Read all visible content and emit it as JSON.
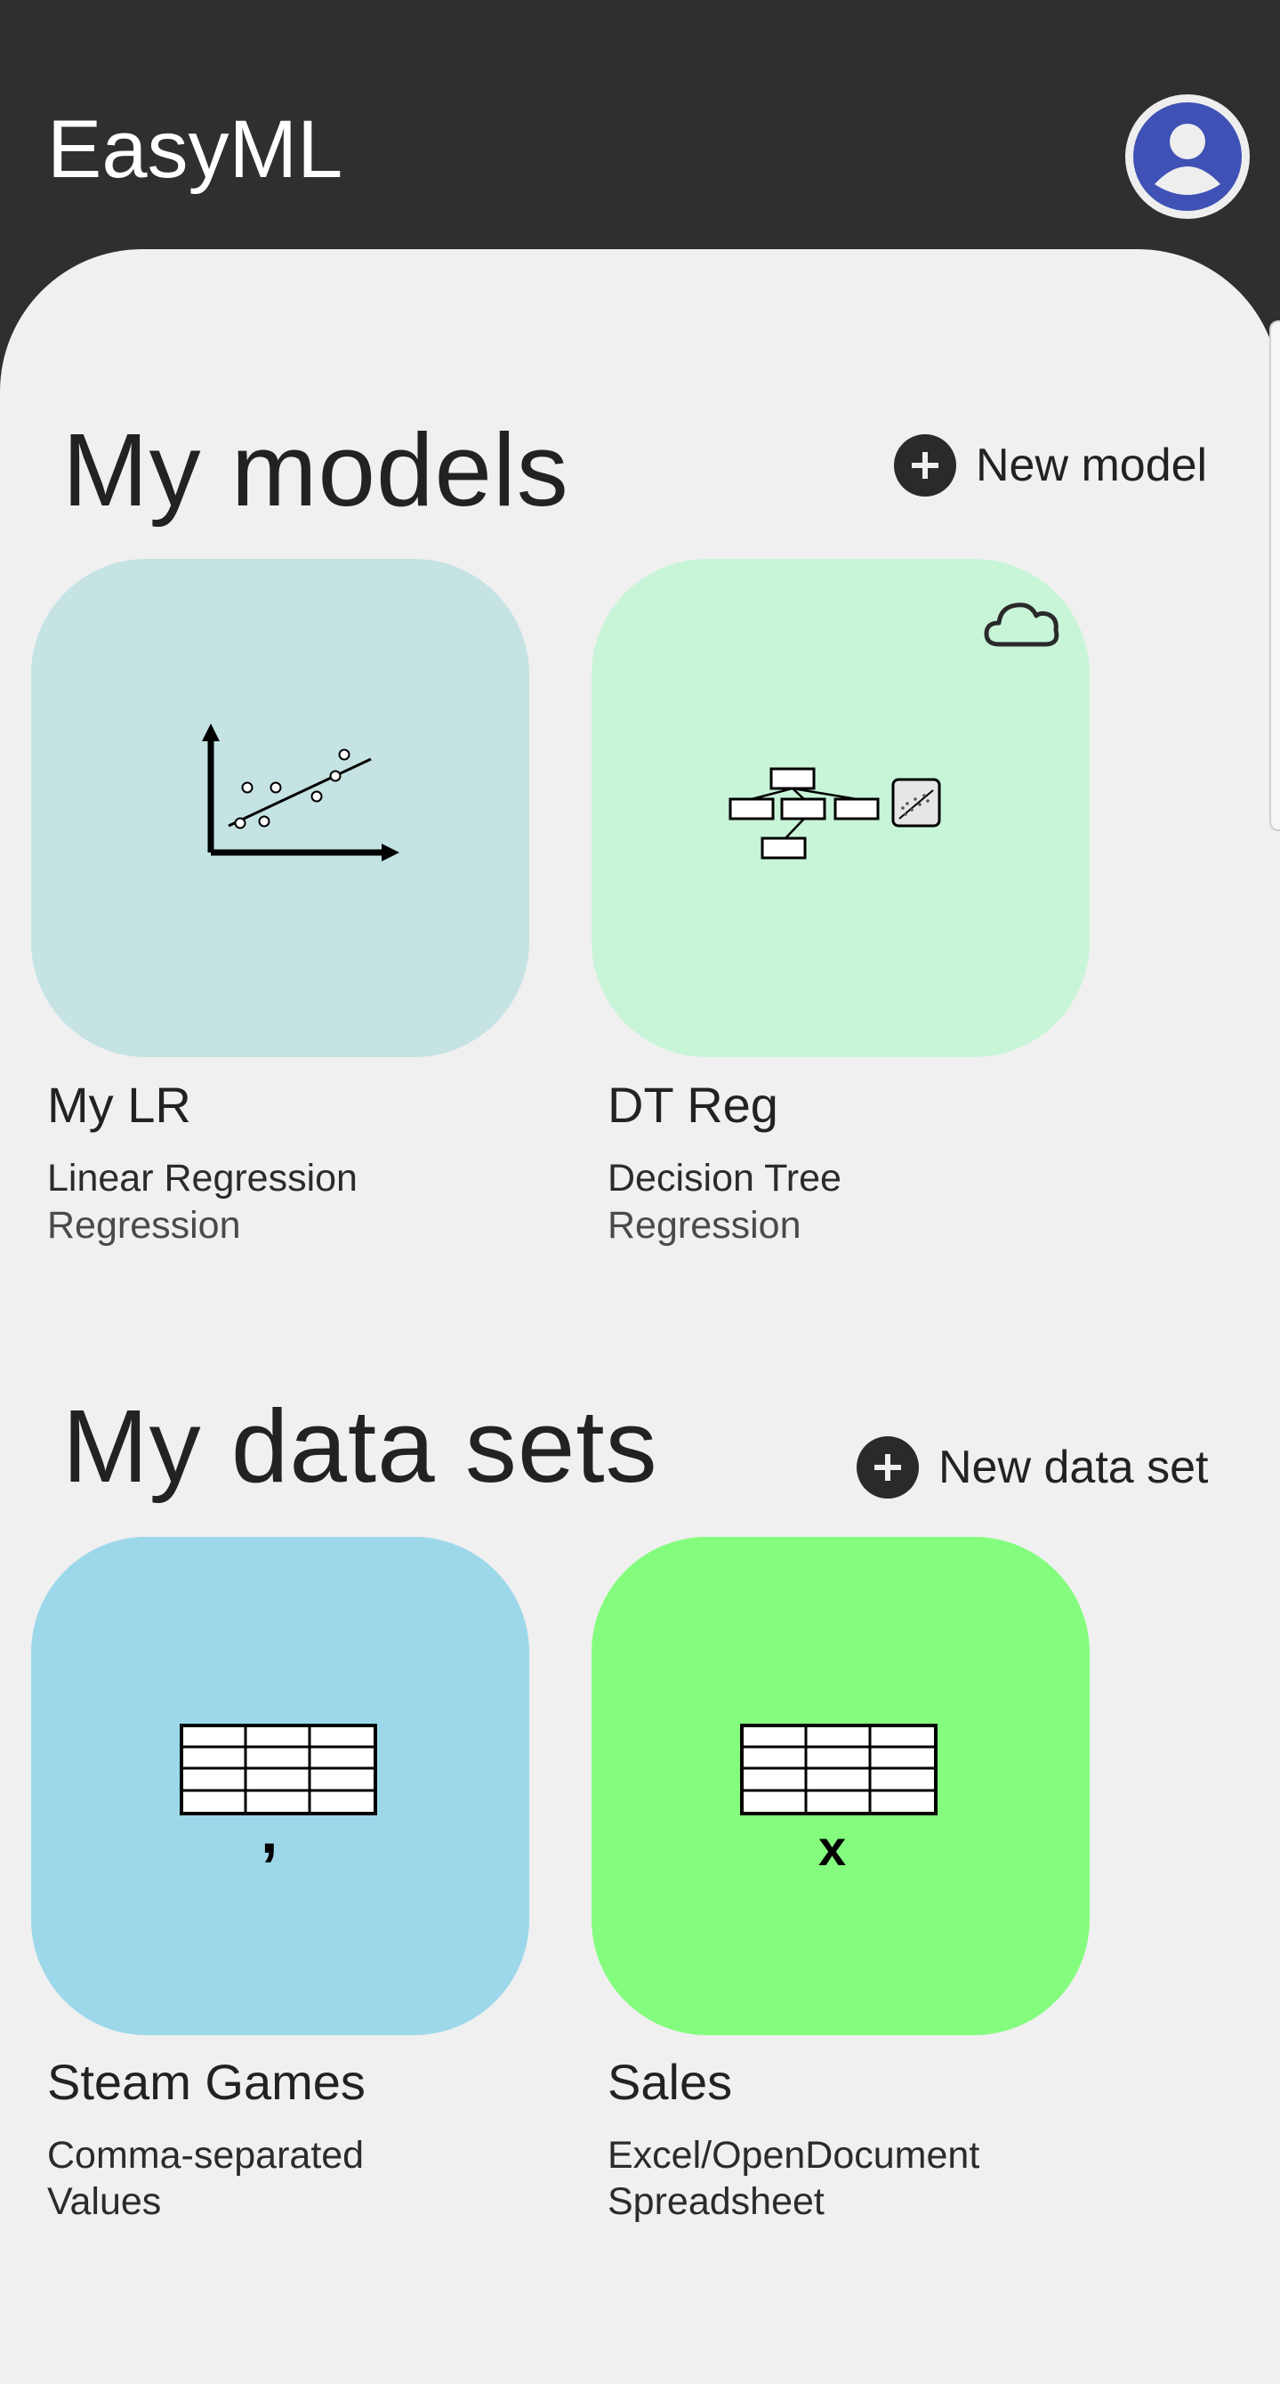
{
  "app": {
    "title": "EasyML",
    "avatar_icon": "account-circle-icon"
  },
  "colors": {
    "app_bar": "#2f2f2f",
    "background": "#f0f0f0",
    "avatar": "#3f51b5",
    "card_lr": "#c5e3e3",
    "card_dt": "#c8f5d8",
    "card_steam": "#9cd8ea",
    "card_sales": "#84fd7e"
  },
  "models": {
    "title": "My models",
    "new_label": "New model",
    "items": [
      {
        "name": "My LR",
        "algorithm": "Linear Regression",
        "task": "Regression",
        "icon": "scatter-plot-icon"
      },
      {
        "name": "DT Reg",
        "algorithm": "Decision Tree",
        "task": "Regression",
        "icon": "decision-tree-icon",
        "badge_icon": "cloud-icon"
      }
    ]
  },
  "datasets": {
    "title": "My data sets",
    "new_label": "New data set",
    "items": [
      {
        "name": "Steam Games",
        "format": "Comma-separated Values",
        "glyph": ",",
        "icon": "table-icon"
      },
      {
        "name": "Sales",
        "format": "Excel/OpenDocument Spreadsheet",
        "glyph": "x",
        "icon": "table-icon"
      }
    ]
  }
}
